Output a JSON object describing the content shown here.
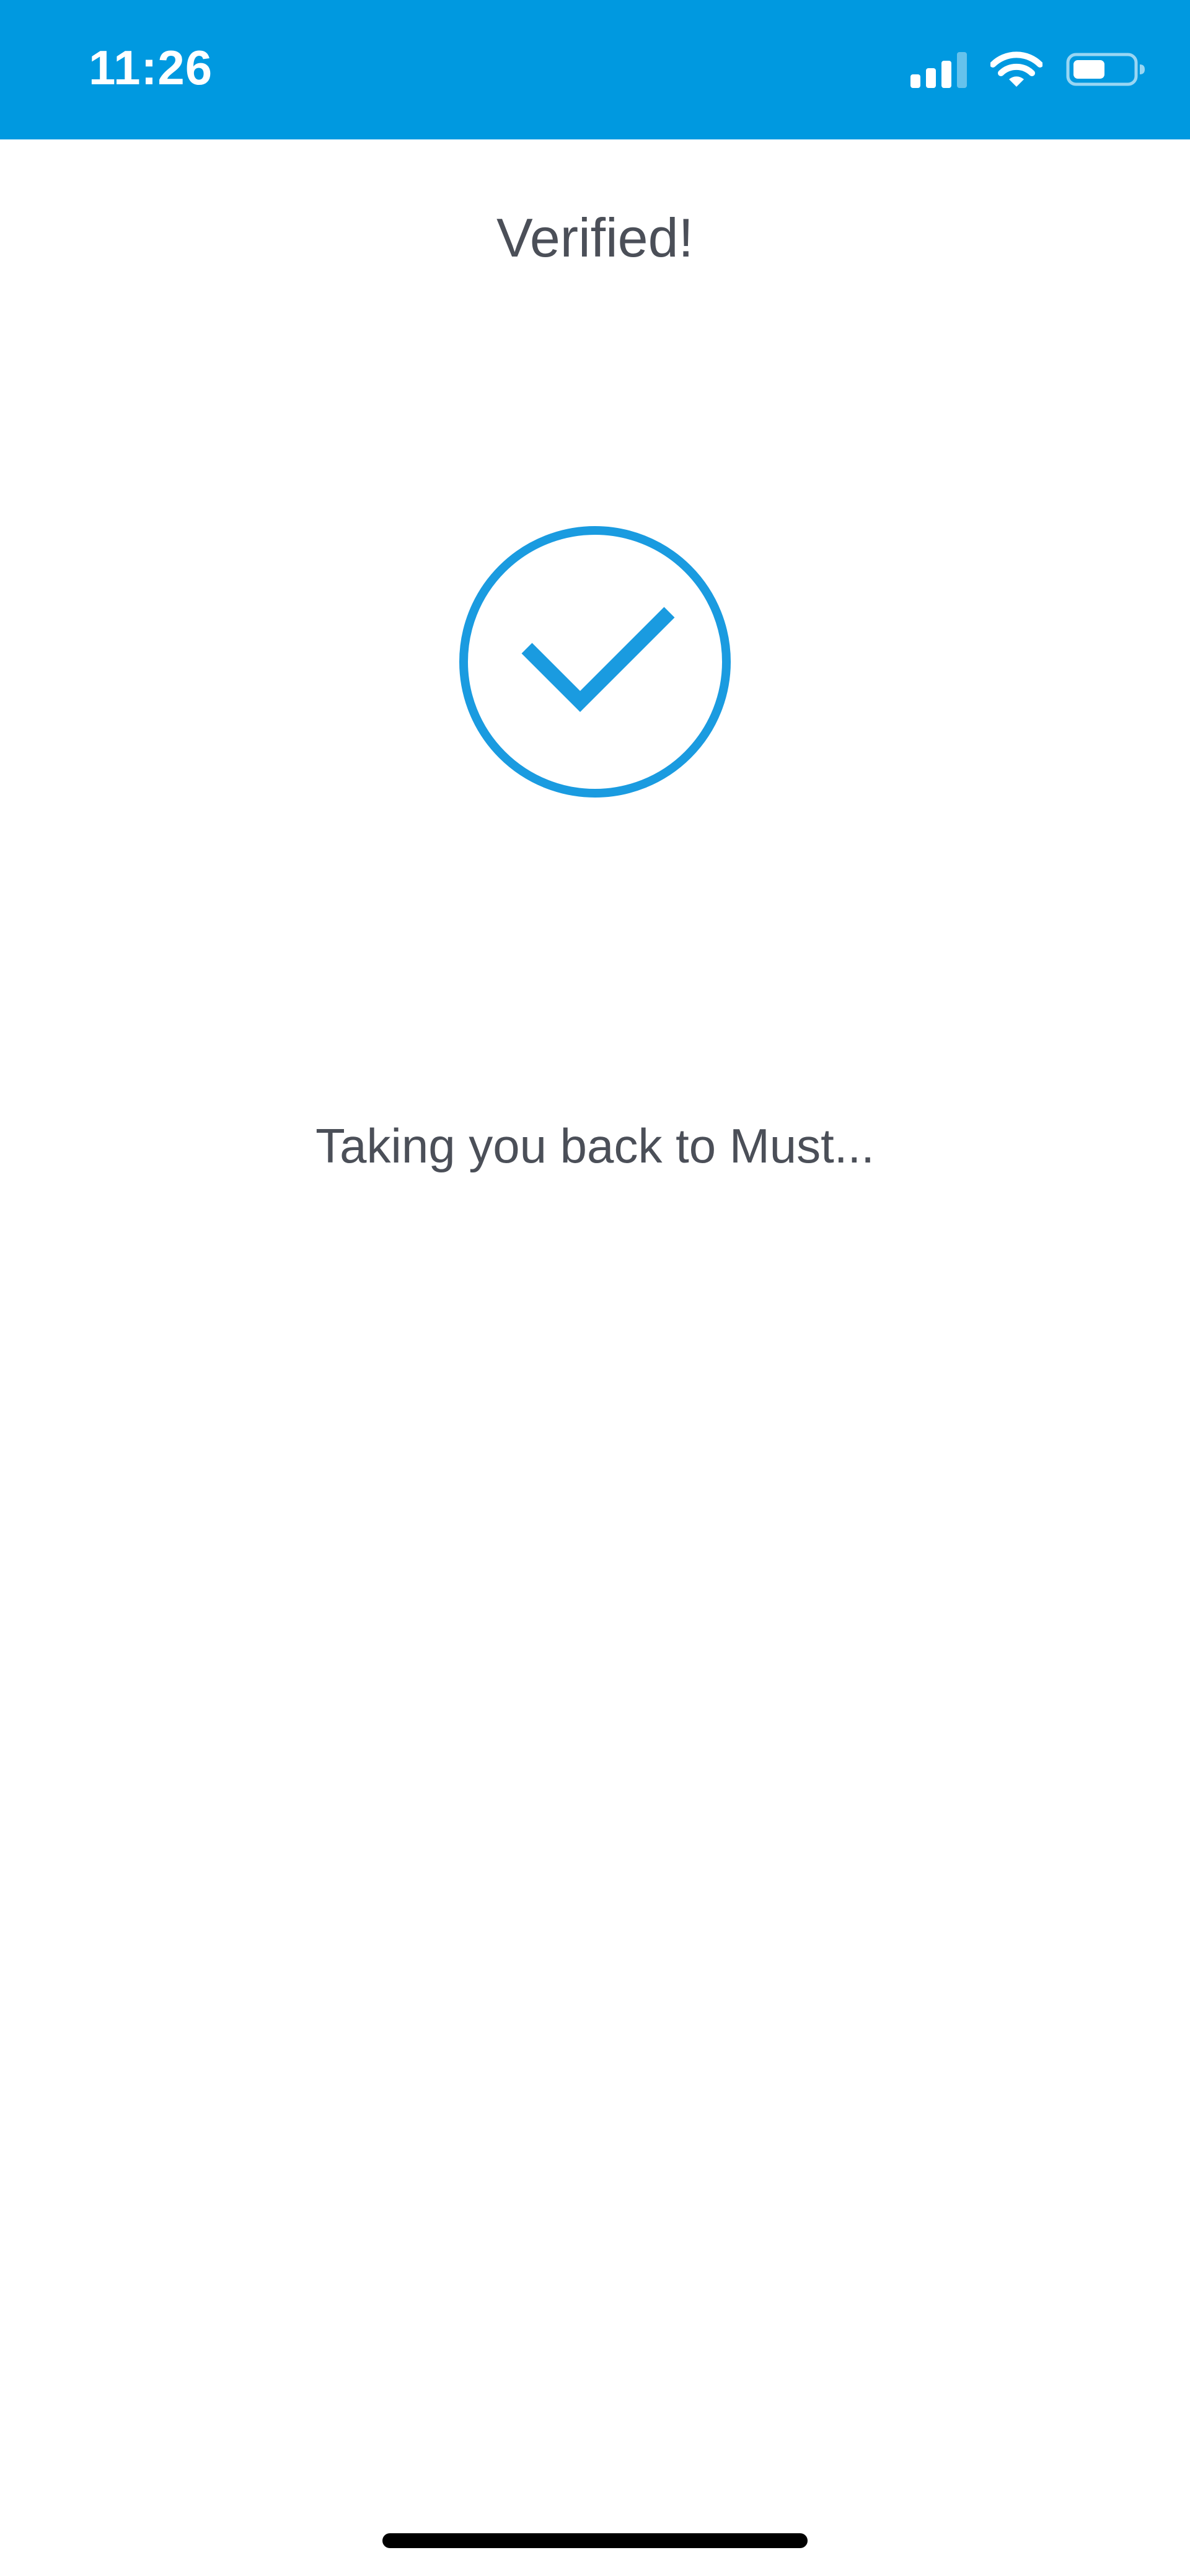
{
  "status_bar": {
    "time": "11:26",
    "icons": [
      "cellular-signal-icon",
      "wifi-icon",
      "battery-icon"
    ],
    "background_color": "#0099e0"
  },
  "main": {
    "title": "Verified!",
    "status_icon": "check-circle-icon",
    "accent_color": "#1a9be0",
    "message": "Taking you back to Must..."
  }
}
